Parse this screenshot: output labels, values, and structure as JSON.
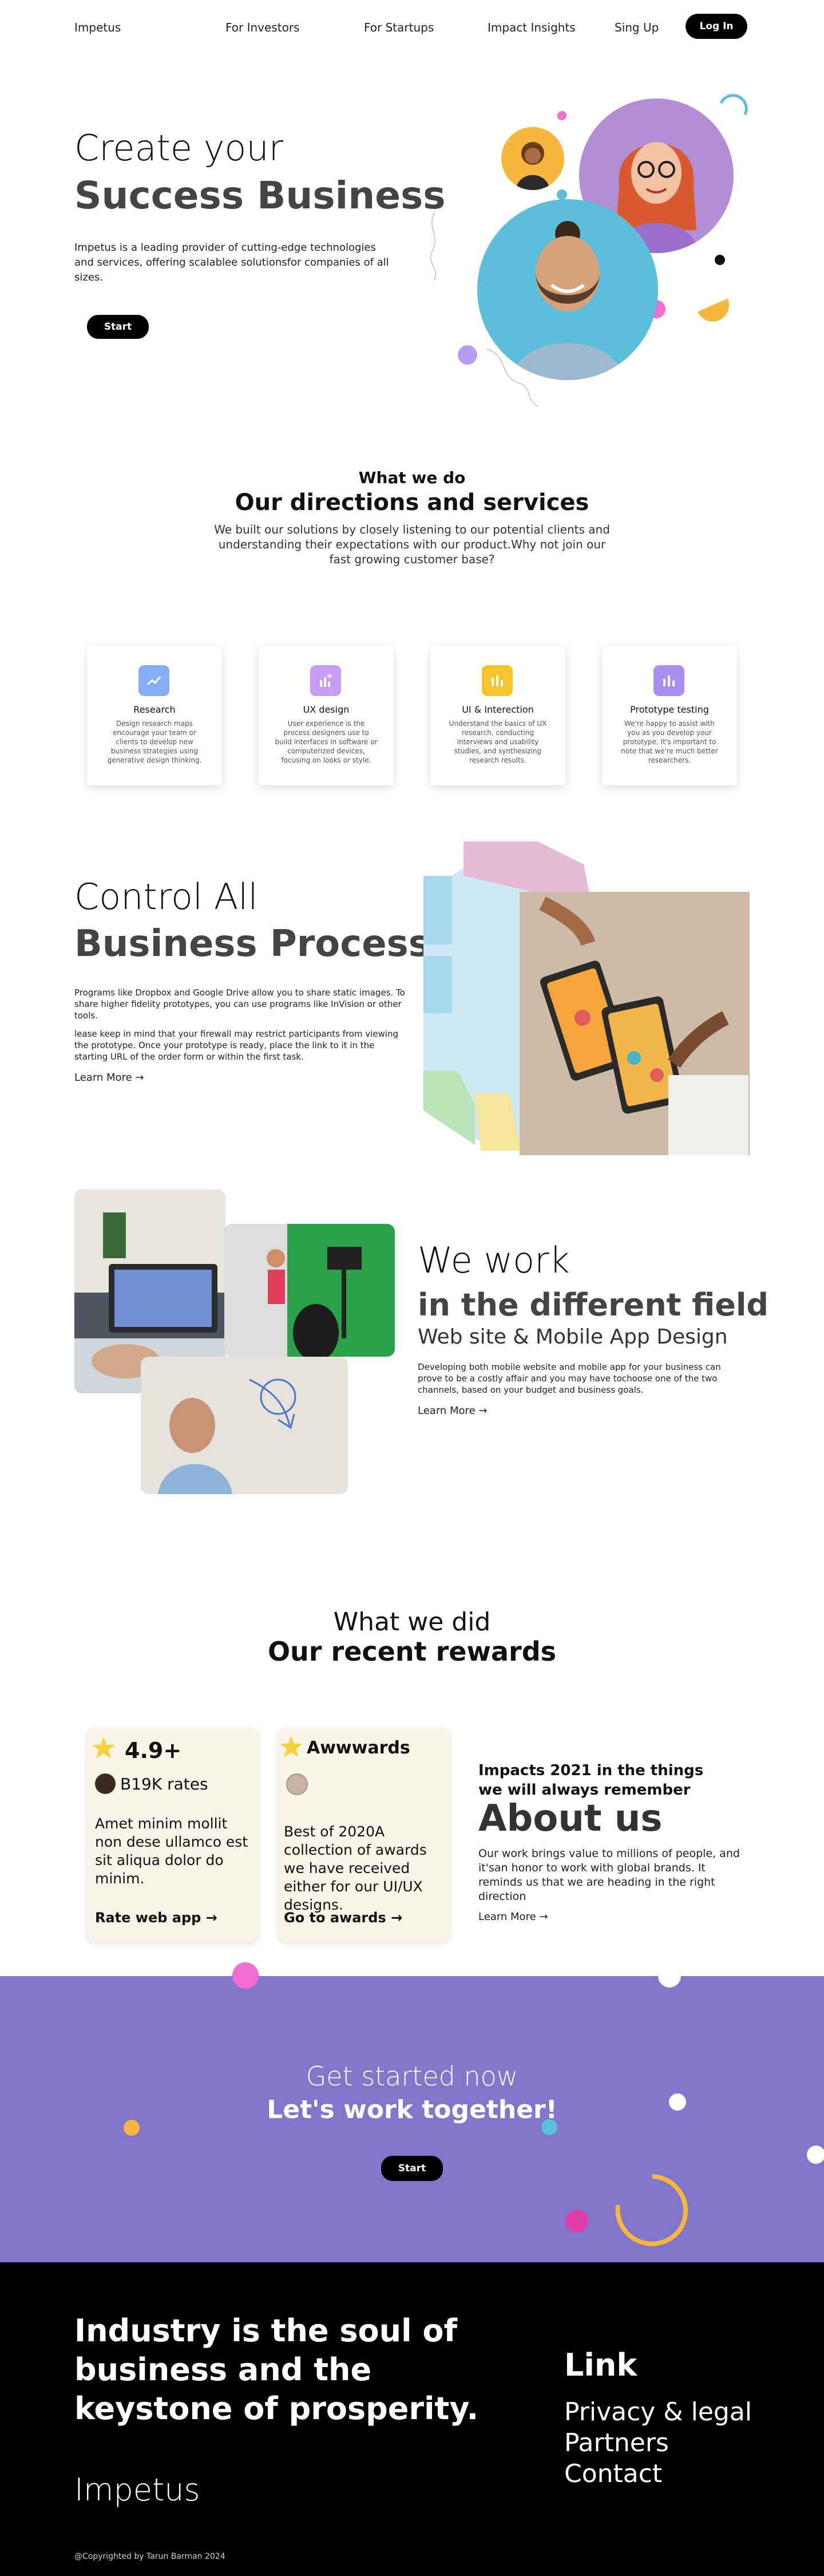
{
  "nav": {
    "logo": "Impetus",
    "links": [
      "For Investors",
      "For Startups",
      "Impact Insights",
      "Sing Up"
    ],
    "login": "Log In"
  },
  "hero": {
    "line1": "Create your",
    "line2": "Success Business",
    "description": "Impetus is a leading provider of cutting-edge technologies and services, offering scalablee solutionsfor companies of all sizes.",
    "button": "Start"
  },
  "services": {
    "label": "What we do",
    "title": "Our directions and services",
    "description": "We built our solutions by closely listening to our potential clients and understanding their expectations with our product.Why not join our fast growing customer base?",
    "cards": [
      {
        "title": "Research",
        "text": "Design research maps encourage your team or clients to develop new business strategies using generative design thinking.",
        "icon": "chart-trend-icon",
        "color": "#86aef7"
      },
      {
        "title": "UX design",
        "text": "User experience is the process designers use to build interfaces in software or computerized devices, focusing on looks or style.",
        "icon": "add-chart-icon",
        "color": "#c79cf6"
      },
      {
        "title": "UI & Interection",
        "text": "Understand the basics of UX research, conducting interviews and usability studies, and synthesizing research results.",
        "icon": "bar-chart-icon",
        "color": "#f6c32c"
      },
      {
        "title": "Prototype testing",
        "text": "We're happy to assist with you as you develop your prototype, It's important to note that we're much better researchers.",
        "icon": "bar-chart-icon",
        "color": "#a990f0"
      }
    ]
  },
  "control": {
    "line1": "Control All",
    "line2": "Business Process",
    "p1": "Programs like Dropbox and Google Drive allow you to share static images. To share higher fidelity prototypes, you can use programs like InVision or other tools.",
    "p2": "lease keep in mind that your firewall may restrict participants from viewing the prototype. Once your prototype is ready, place the link to it in the starting URL of the order form or within the first task.",
    "learn_more": "Learn More →"
  },
  "work": {
    "line1": "We work",
    "line2": "in the different field",
    "line3": "Web site & Mobile App Design",
    "description": "Developing both mobile website and mobile app for your business can prove to be a costly affair and you may have tochoose one of the two channels, based on your budget and business goals.",
    "learn_more": "Learn More →"
  },
  "rewards": {
    "label": "What we did",
    "title": "Our recent rewards",
    "card1": {
      "headline": "4.9+",
      "sub": "B19K rates",
      "body": "Amet minim mollit non dese ullamco est sit aliqua dolor do minim.",
      "link": "Rate web app →"
    },
    "card2": {
      "headline": "Awwwards",
      "body": "Best of 2020A collection of awards we have received either for our UI/UX designs.",
      "link": "Go to awards →"
    },
    "about": {
      "kicker": "Impacts 2021 in the things we will always remember",
      "title": "About us",
      "body": "Our work brings value to millions of people, and it'san honor to work with global brands. It reminds us that we are heading in the right direction",
      "link": "Learn More →"
    }
  },
  "cta": {
    "line1": "Get started now",
    "line2": "Let's work together!",
    "button": "Start"
  },
  "footer": {
    "tagline": "Industry is the soul of business and the keystone of prosperity.",
    "logo": "Impetus",
    "links_title": "Link",
    "links": [
      "Privacy & legal",
      "Partners",
      "Contact"
    ],
    "copyright": "@Copyrighted by Tarun Barman 2024"
  },
  "colors": {
    "accent_purple": "#8176cb",
    "yellow": "#f6b73c",
    "pink": "#f06ccf",
    "cyan": "#5bbfdc",
    "card_cream": "#f8f5e6"
  }
}
